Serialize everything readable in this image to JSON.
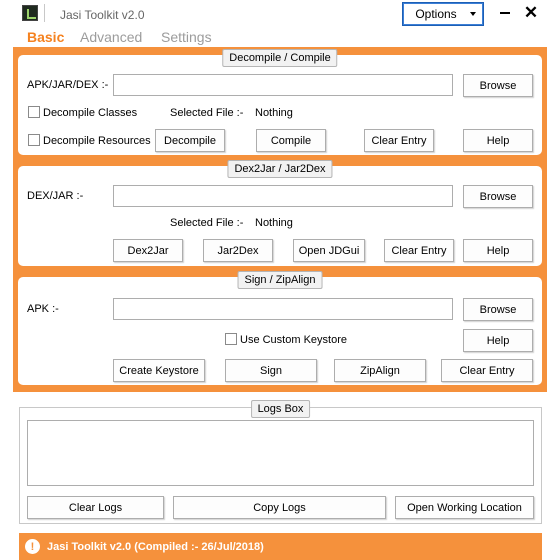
{
  "window": {
    "title": "Jasi Toolkit v2.0",
    "options_label": "Options",
    "minimize_symbol": "",
    "close_symbol": "✕"
  },
  "tabs": [
    {
      "label": "Basic"
    },
    {
      "label": "Advanced"
    },
    {
      "label": "Settings"
    }
  ],
  "decompile": {
    "title": "Decompile / Compile",
    "input_label": "APK/JAR/DEX :-",
    "input_value": "",
    "browse": "Browse",
    "decompile_classes": "Decompile Classes",
    "decompile_resources": "Decompile Resources",
    "selected_file_label": "Selected File :-",
    "selected_file_value": "Nothing",
    "decompile_btn": "Decompile",
    "compile_btn": "Compile",
    "clear_entry": "Clear Entry",
    "help": "Help"
  },
  "dex2jar": {
    "title": "Dex2Jar / Jar2Dex",
    "input_label": "DEX/JAR :-",
    "input_value": "",
    "browse": "Browse",
    "selected_file_label": "Selected File :-",
    "selected_file_value": "Nothing",
    "dex2jar_btn": "Dex2Jar",
    "jar2dex_btn": "Jar2Dex",
    "open_jdgui": "Open JDGui",
    "clear_entry": "Clear Entry",
    "help": "Help"
  },
  "sign": {
    "title": "Sign / ZipAlign",
    "input_label": "APK :-",
    "input_value": "",
    "browse": "Browse",
    "use_custom_keystore": "Use Custom Keystore",
    "help": "Help",
    "create_keystore": "Create Keystore",
    "sign_btn": "Sign",
    "zipalign_btn": "ZipAlign",
    "clear_entry": "Clear Entry"
  },
  "logs": {
    "title": "Logs Box",
    "content": "",
    "clear_logs": "Clear Logs",
    "copy_logs": "Copy Logs",
    "open_working_location": "Open Working Location"
  },
  "status": {
    "icon": "!",
    "text": "Jasi Toolkit v2.0 (Compiled :- 26/Jul/2018)"
  },
  "colors": {
    "accent": "#f5913c",
    "active_tab": "#f58220",
    "inactive_tab": "#9c9c9c"
  }
}
